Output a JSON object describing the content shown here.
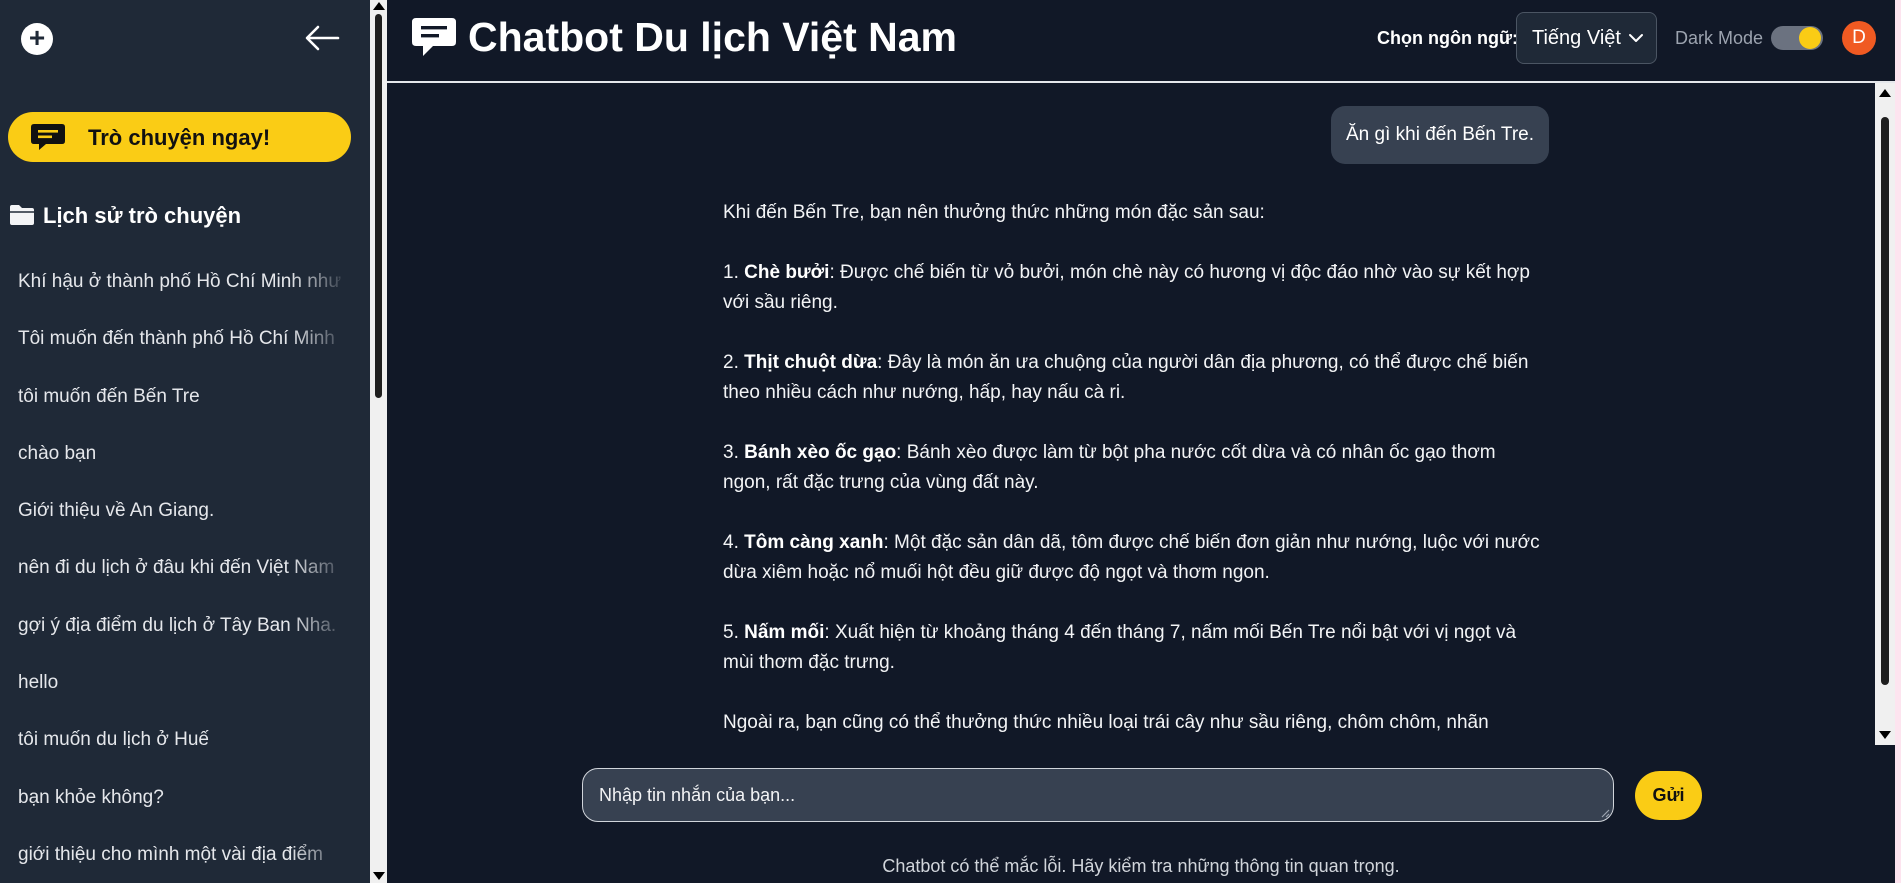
{
  "sidebar": {
    "new_chat_icon": "plus-icon",
    "collapse_icon": "arrow-left-icon",
    "chat_now_label": "Trò chuyện ngay!",
    "history_title": "Lịch sử trò chuyện",
    "history_items": [
      "Khí hậu ở thành phố Hồ Chí Minh như",
      "Tôi muốn đến thành phố Hồ Chí Minh",
      "tôi muốn đến Bến Tre",
      "chào bạn",
      "Giới thiệu về An Giang.",
      "nên đi du lịch ở đâu khi đến Việt Nam",
      "gợi ý địa điểm du lịch ở Tây Ban Nha.",
      "hello",
      "tôi muốn du lịch ở Huế",
      "bạn khỏe không?",
      "giới thiệu cho mình một vài địa điểm"
    ]
  },
  "header": {
    "title": "Chatbot Du lịch Việt Nam",
    "language_label": "Chọn ngôn ngữ:",
    "language_value": "Tiếng Việt",
    "dark_mode_label": "Dark Mode",
    "dark_mode_on": true,
    "avatar_initial": "D"
  },
  "chat": {
    "user_message": "Ăn gì khi đến Bến Tre.",
    "bot_intro": "Khi đến Bến Tre, bạn nên thưởng thức những món đặc sản sau:",
    "bot_items": [
      {
        "num": "1.",
        "name": "Chè bưởi",
        "text": ": Được chế biến từ vỏ bưởi, món chè này có hương vị độc đáo nhờ vào sự kết hợp với sầu riêng."
      },
      {
        "num": "2.",
        "name": "Thịt chuột dừa",
        "text": ": Đây là món ăn ưa chuộng của người dân địa phương, có thể được chế biến theo nhiều cách như nướng, hấp, hay nấu cà ri."
      },
      {
        "num": "3.",
        "name": "Bánh xèo ốc gạo",
        "text": ": Bánh xèo được làm từ bột pha nước cốt dừa và có nhân ốc gạo thơm ngon, rất đặc trưng của vùng đất này."
      },
      {
        "num": "4.",
        "name": "Tôm càng xanh",
        "text": ": Một đặc sản dân dã, tôm được chế biến đơn giản như nướng, luộc với nước dừa xiêm hoặc nổ muối hột đều giữ được độ ngọt và thơm ngon."
      },
      {
        "num": "5.",
        "name": "Nấm mối",
        "text": ": Xuất hiện từ khoảng tháng 4 đến tháng 7, nấm mối Bến Tre nổi bật với vị ngọt và mùi thơm đặc trưng."
      }
    ],
    "bot_outro": "Ngoài ra, bạn cũng có thể thưởng thức nhiều loại trái cây như sầu riêng, chôm chôm, nhãn"
  },
  "composer": {
    "placeholder": "Nhập tin nhắn của bạn...",
    "send_label": "Gửi"
  },
  "footer": {
    "note": "Chatbot có thể mắc lỗi. Hãy kiểm tra những thông tin quan trọng."
  },
  "colors": {
    "sidebar_bg": "#1f2937",
    "main_bg": "#111827",
    "accent": "#facc15",
    "bubble_bg": "#374151",
    "avatar_bg": "#f05a22"
  }
}
